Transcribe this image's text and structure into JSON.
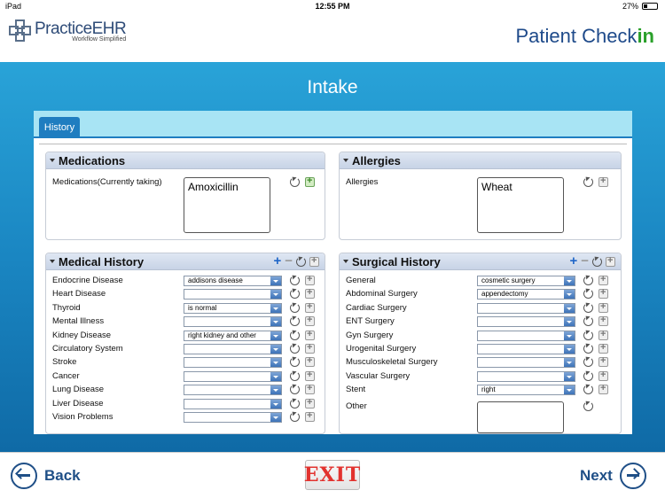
{
  "status_bar": {
    "device": "iPad",
    "time": "12:55 PM",
    "battery": "27%"
  },
  "header": {
    "logo_main": "PracticeEHR",
    "logo_tagline": "Workflow Simplified",
    "brand_prefix": "Patient Check",
    "brand_suffix": "in"
  },
  "page": {
    "title": "Intake"
  },
  "tabs": [
    {
      "label": "History"
    }
  ],
  "medications": {
    "title": "Medications",
    "field_label": "Medications(Currently taking)",
    "value": "Amoxicillin"
  },
  "allergies": {
    "title": "Allergies",
    "field_label": "Allergies",
    "value": "Wheat"
  },
  "medical_history": {
    "title": "Medical History",
    "rows": [
      {
        "label": "Endocrine Disease",
        "value": "addisons disease"
      },
      {
        "label": "Heart Disease",
        "value": ""
      },
      {
        "label": "Thyroid",
        "value": "is normal"
      },
      {
        "label": "Mental Illness",
        "value": ""
      },
      {
        "label": "Kidney Disease",
        "value": "right kidney and other"
      },
      {
        "label": "Circulatory System",
        "value": ""
      },
      {
        "label": "Stroke",
        "value": ""
      },
      {
        "label": "Cancer",
        "value": ""
      },
      {
        "label": "Lung Disease",
        "value": ""
      },
      {
        "label": "Liver Disease",
        "value": ""
      },
      {
        "label": "Vision Problems",
        "value": ""
      }
    ]
  },
  "surgical_history": {
    "title": "Surgical History",
    "rows": [
      {
        "label": "General",
        "value": "cosmetic surgery"
      },
      {
        "label": "Abdominal Surgery",
        "value": "appendectomy"
      },
      {
        "label": "Cardiac Surgery",
        "value": ""
      },
      {
        "label": "ENT Surgery",
        "value": ""
      },
      {
        "label": "Gyn Surgery",
        "value": ""
      },
      {
        "label": "Urogenital Surgery",
        "value": ""
      },
      {
        "label": "Musculoskeletal Surgery",
        "value": ""
      },
      {
        "label": "Vascular Surgery",
        "value": ""
      },
      {
        "label": "Stent",
        "value": "right"
      }
    ],
    "other_label": "Other",
    "other_value": ""
  },
  "footer": {
    "back_label": "Back",
    "exit_label": "EXIT",
    "next_label": "Next"
  }
}
